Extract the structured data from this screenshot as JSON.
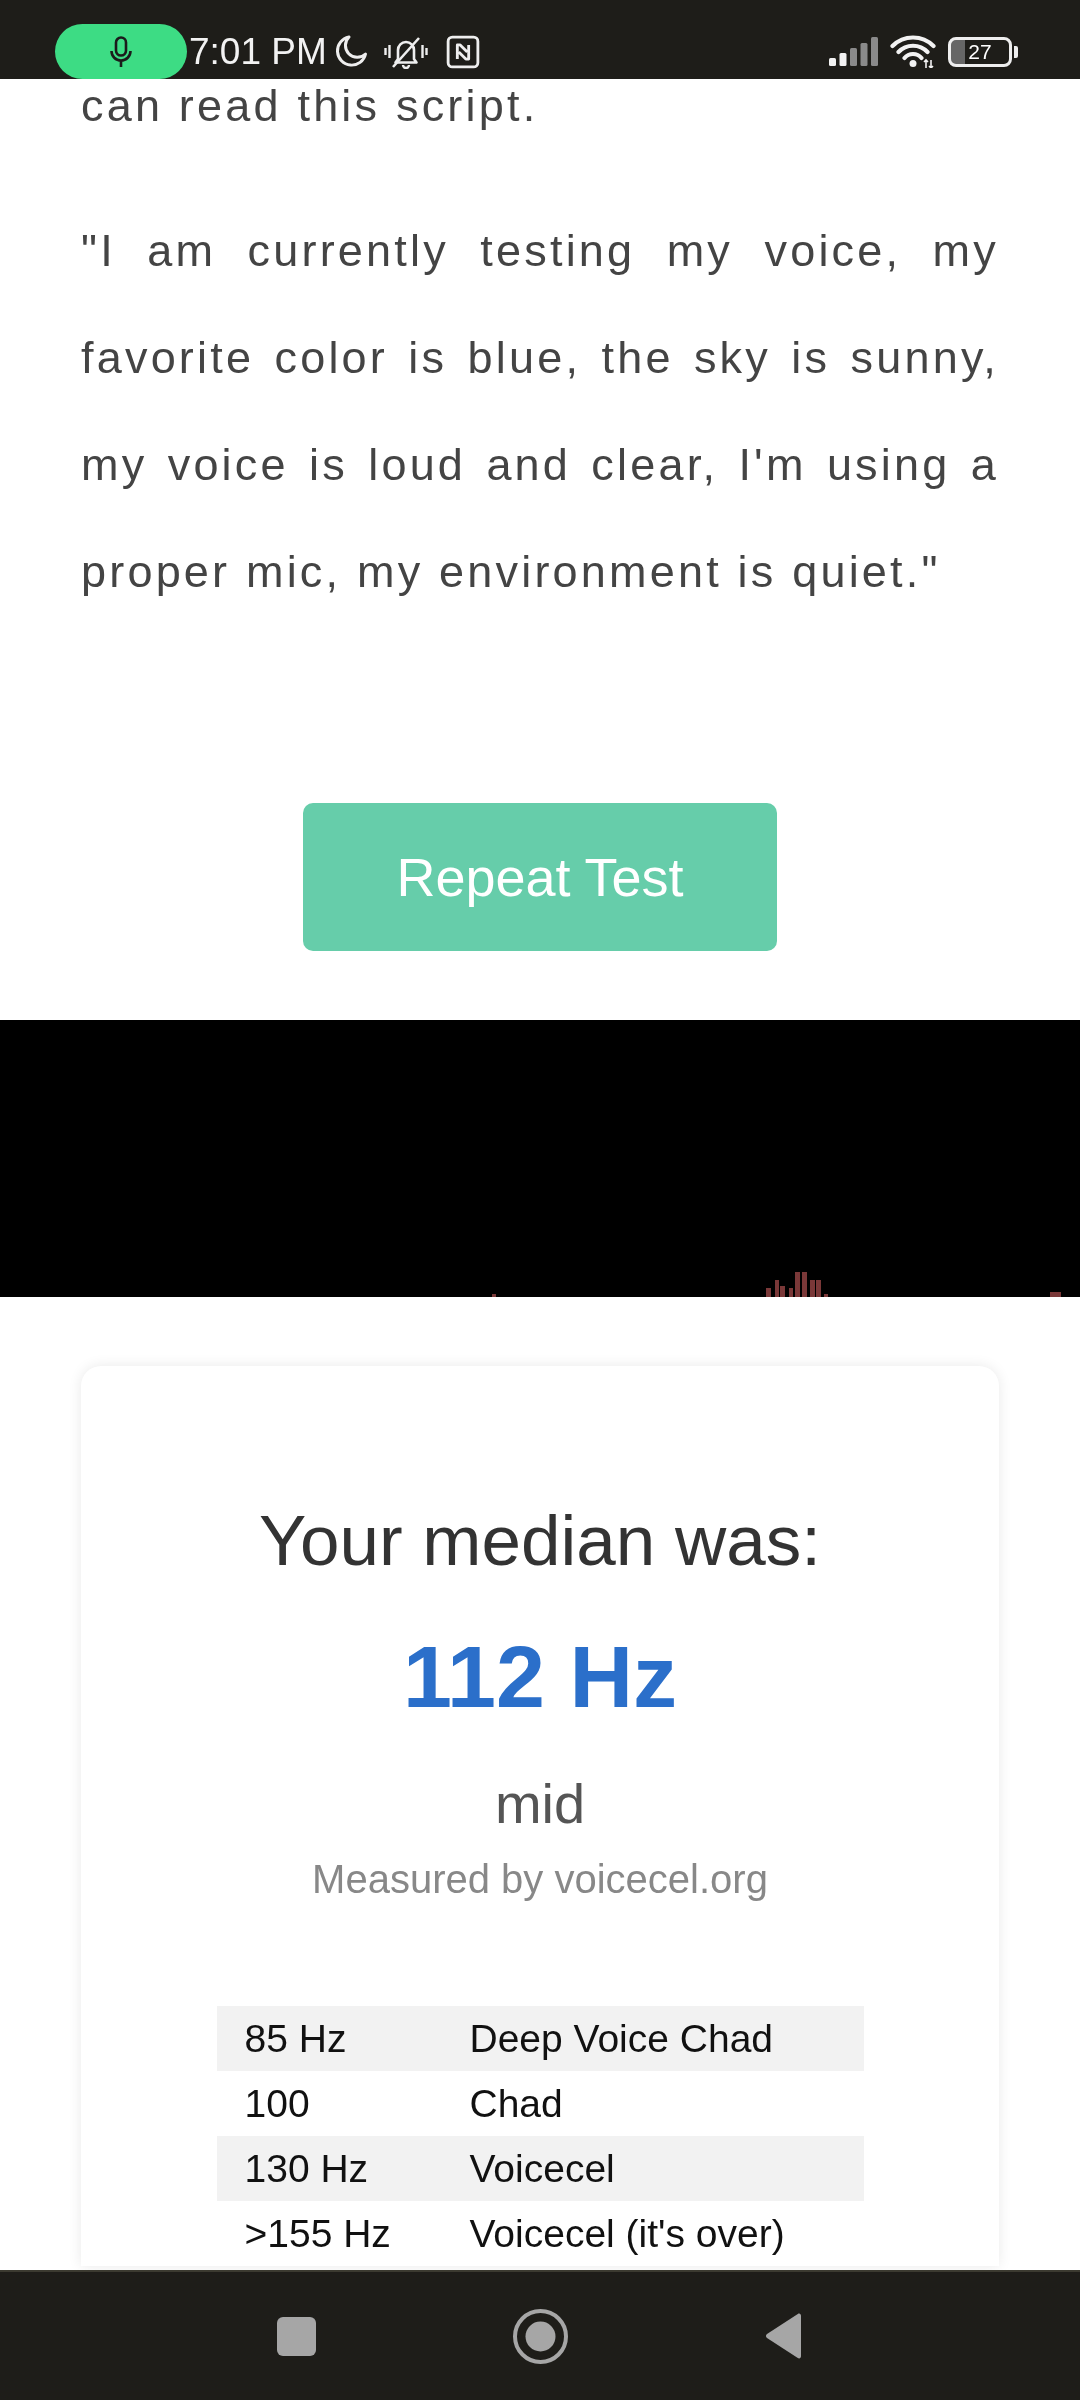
{
  "status_bar": {
    "time": "7:01 PM",
    "battery": "27"
  },
  "script": {
    "intro_tail": "can read this script.",
    "quote": "\"I am currently testing my voice, my favorite color is blue, the sky is sunny, my voice is loud and clear, I'm using a proper mic, my environment is quiet.\""
  },
  "repeat_button": {
    "label": "Repeat Test"
  },
  "result_card": {
    "heading": "Your median was:",
    "median": "112 Hz",
    "category": "mid",
    "credit": "Measured by voicecel.org",
    "table": {
      "rows": [
        {
          "cells": [
            "85 Hz",
            "Deep Voice Chad"
          ]
        },
        {
          "cells": [
            "100",
            "Chad"
          ]
        },
        {
          "cells": [
            "130 Hz",
            "Voicecel"
          ]
        },
        {
          "cells": [
            ">155 Hz",
            "Voicecel (it's over)"
          ]
        }
      ]
    }
  }
}
